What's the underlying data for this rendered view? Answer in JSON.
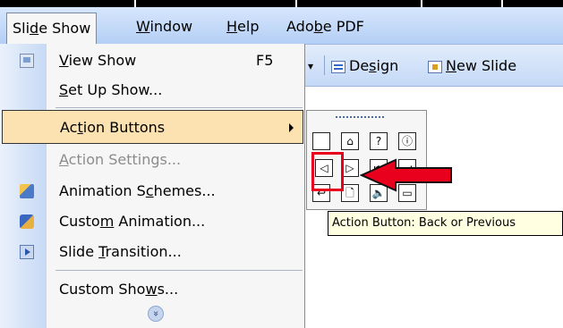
{
  "menubar": {
    "items": [
      {
        "pre": "Sli",
        "key": "d",
        "post": "e Show"
      },
      {
        "pre": "",
        "key": "W",
        "post": "indow"
      },
      {
        "pre": "",
        "key": "H",
        "post": "elp"
      },
      {
        "pre": "Ado",
        "key": "b",
        "post": "e PDF"
      }
    ]
  },
  "toolbar": {
    "design": {
      "pre": "De",
      "key": "s",
      "post": "ign"
    },
    "new_slide": {
      "pre": "",
      "key": "N",
      "post": "ew Slide"
    }
  },
  "menu": {
    "items": [
      {
        "pre": "",
        "key": "V",
        "post": "iew Show",
        "shortcut": "F5",
        "icon": "slide-show-icon"
      },
      {
        "pre": "",
        "key": "S",
        "post": "et Up Show..."
      },
      {
        "pre": "Ac",
        "key": "t",
        "post": "ion Buttons",
        "state": "highlighted",
        "submenu": true
      },
      {
        "pre": "",
        "key": "A",
        "post": "ction Settings...",
        "state": "disabled"
      },
      {
        "pre": "Animation S",
        "key": "c",
        "post": "hemes...",
        "icon": "animation-schemes-icon"
      },
      {
        "pre": "Custo",
        "key": "m",
        "post": " Animation...",
        "icon": "custom-animation-icon"
      },
      {
        "pre": "Slide ",
        "key": "T",
        "post": "ransition...",
        "icon": "slide-transition-icon"
      },
      {
        "pre": "Custom Sho",
        "key": "w",
        "post": "s..."
      }
    ],
    "expand_icon": "double-chevron-down-icon"
  },
  "palette": {
    "buttons": [
      {
        "glyph": "",
        "name": "custom"
      },
      {
        "glyph": "⌂",
        "name": "home"
      },
      {
        "glyph": "?",
        "name": "help"
      },
      {
        "glyph": "ⓘ",
        "name": "information"
      },
      {
        "glyph": "◁",
        "name": "back-or-previous"
      },
      {
        "glyph": "▷",
        "name": "forward-or-next"
      },
      {
        "glyph": "⏮",
        "name": "beginning"
      },
      {
        "glyph": "⏭",
        "name": "end"
      },
      {
        "glyph": "↩",
        "name": "return"
      },
      {
        "glyph": "🗋",
        "name": "document"
      },
      {
        "glyph": "🔈",
        "name": "sound"
      },
      {
        "glyph": "▭",
        "name": "movie"
      }
    ]
  },
  "tooltip": {
    "text": "Action Button: Back or Previous"
  },
  "colors": {
    "highlight": "#fbe2b0",
    "callout": "#e8001c",
    "tooltip_bg": "#ffffe1"
  }
}
